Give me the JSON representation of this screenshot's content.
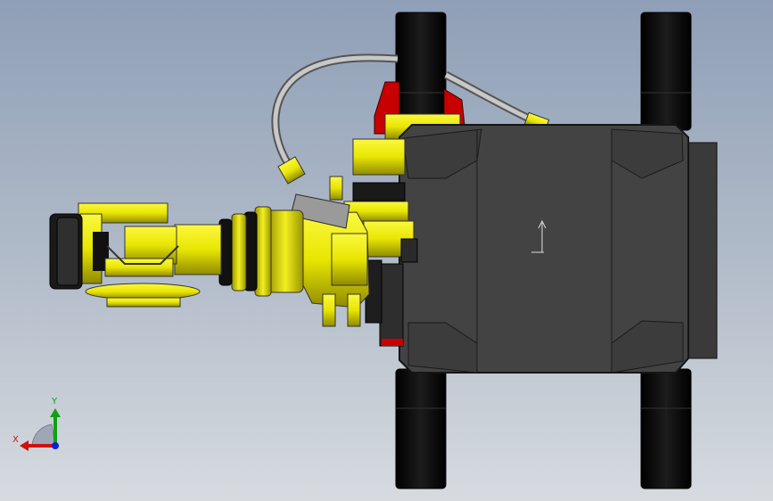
{
  "viewport": {
    "background_top": "#8f9fb7",
    "background_bottom": "#d7dbe0"
  },
  "model": {
    "colors": {
      "arm_yellow": "#e8e600",
      "arm_yellow_dark": "#8f8a00",
      "body_gray": "#414141",
      "body_edge": "#1a1a1a",
      "track_black": "#0b0b0b",
      "accent_red": "#c80000",
      "cable_gray": "#a8a8a8"
    },
    "parts": [
      "chassis",
      "tracks",
      "turret",
      "arm",
      "gripper",
      "cable"
    ]
  },
  "triad": {
    "x_label": "X",
    "y_label": "Y",
    "x_color": "#d01010",
    "y_color": "#10a010",
    "z_color": "#1020d0"
  }
}
